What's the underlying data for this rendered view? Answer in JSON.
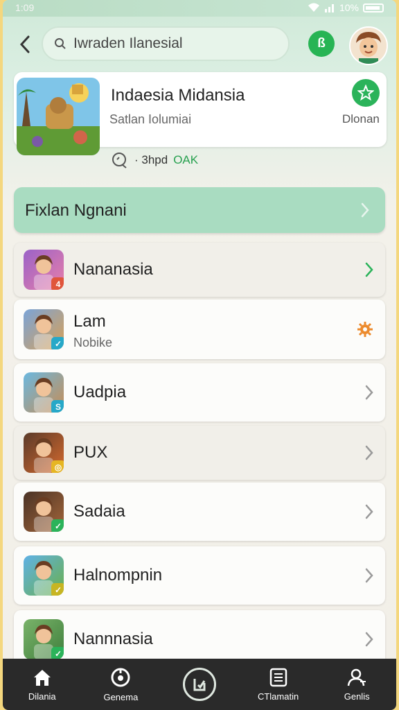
{
  "status": {
    "time": "1:09",
    "battery": "10%"
  },
  "search": {
    "text": "Iwraden Ilanesial",
    "action_glyph": "ß"
  },
  "featured": {
    "title": "Indaesia Midansia",
    "subtitle": "Satlan Iolumiai",
    "right_label": "Dlonan",
    "meta_prefix": "· 3hpd",
    "meta_highlight": "OAK"
  },
  "banner": {
    "label": "Fixlan Ngnani"
  },
  "rows": [
    {
      "title": "Nananasia",
      "subtitle": "",
      "trail": "chevron-green",
      "badge": "4",
      "badge_color": "#e0553b",
      "bg1": "#9a62c8",
      "bg2": "#e87fa9"
    },
    {
      "title": "Lam",
      "subtitle": "Nobike",
      "trail": "gear",
      "badge": "✓",
      "badge_color": "#27a8c8",
      "bg1": "#7aa4d8",
      "bg2": "#d9a055"
    },
    {
      "title": "Uadpia",
      "subtitle": "",
      "trail": "chevron",
      "badge": "S",
      "badge_color": "#27a8c8",
      "bg1": "#6ab8e0",
      "bg2": "#c98c52"
    },
    {
      "title": "PUX",
      "subtitle": "",
      "trail": "chevron",
      "badge": "◎",
      "badge_color": "#e6b623",
      "bg1": "#5a3a2a",
      "bg2": "#d66a2e"
    },
    {
      "title": "Sadaia",
      "subtitle": "",
      "trail": "chevron",
      "badge": "✓",
      "badge_color": "#2bb35a",
      "bg1": "#4a3326",
      "bg2": "#a4663a"
    },
    {
      "title": "Halnompnin",
      "subtitle": "",
      "trail": "chevron",
      "badge": "✓",
      "badge_color": "#c7b522",
      "bg1": "#5fb1e6",
      "bg2": "#6bb04a"
    },
    {
      "title": "Nannnasia",
      "subtitle": "",
      "trail": "chevron",
      "badge": "✓",
      "badge_color": "#2bb35a",
      "bg1": "#7ab36a",
      "bg2": "#3f7f3c"
    }
  ],
  "nav": [
    {
      "label": "Dilania",
      "icon": "home-icon"
    },
    {
      "label": "Genema",
      "icon": "game-icon"
    },
    {
      "label": "",
      "icon": "center-action-icon"
    },
    {
      "label": "CTlamatin",
      "icon": "list-icon"
    },
    {
      "label": "Genlis",
      "icon": "profile-icon"
    }
  ],
  "colors": {
    "accent": "#27b454",
    "banner": "#a9dcc1",
    "nav": "#2a2a2a"
  }
}
